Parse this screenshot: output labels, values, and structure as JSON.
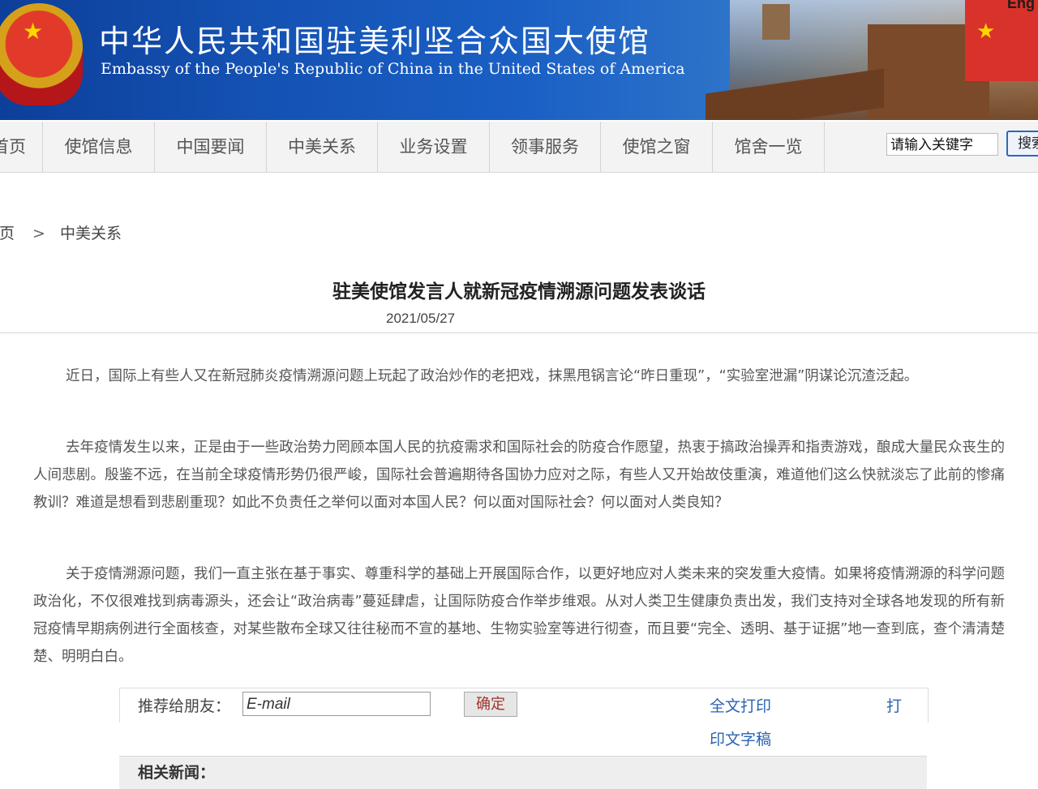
{
  "header": {
    "title_cn": "中华人民共和国驻美利坚合众国大使馆",
    "title_en": "Embassy of the People's Republic of China in the United States of America",
    "lang_link": "Eng"
  },
  "nav": {
    "items": [
      {
        "label": "首页"
      },
      {
        "label": "使馆信息"
      },
      {
        "label": "中国要闻"
      },
      {
        "label": "中美关系"
      },
      {
        "label": "业务设置"
      },
      {
        "label": "领事服务"
      },
      {
        "label": "使馆之窗"
      },
      {
        "label": "馆舍一览"
      }
    ],
    "search_placeholder": "请输入关键字",
    "search_button": "搜索"
  },
  "breadcrumb": {
    "home": "首页",
    "separator": ">",
    "current": "中美关系"
  },
  "article": {
    "title": "驻美使馆发言人就新冠疫情溯源问题发表谈话",
    "date": "2021/05/27",
    "paragraphs": [
      "近日，国际上有些人又在新冠肺炎疫情溯源问题上玩起了政治炒作的老把戏，抹黑甩锅言论“昨日重现”，“实验室泄漏”阴谋论沉渣泛起。",
      "去年疫情发生以来，正是由于一些政治势力罔顾本国人民的抗疫需求和国际社会的防疫合作愿望，热衷于搞政治操弄和指责游戏，酿成大量民众丧生的人间悲剧。殷鉴不远，在当前全球疫情形势仍很严峻，国际社会普遍期待各国协力应对之际，有些人又开始故伎重演，难道他们这么快就淡忘了此前的惨痛教训？难道是想看到悲剧重现？如此不负责任之举何以面对本国人民？何以面对国际社会？何以面对人类良知？",
      "关于疫情溯源问题，我们一直主张在基于事实、尊重科学的基础上开展国际合作，以更好地应对人类未来的突发重大疫情。如果将疫情溯源的科学问题政治化，不仅很难找到病毒源头，还会让“政治病毒”蔓延肆虐，让国际防疫合作举步维艰。从对人类卫生健康负责出发，我们支持对全球各地发现的所有新冠疫情早期病例进行全面核查，对某些散布全球又往往秘而不宣的基地、生物实验室等进行彻查，而且要“完全、透明、基于证据”地一查到底，查个清清楚楚、明明白白。"
    ]
  },
  "share": {
    "label": "推荐给朋友：",
    "email_placeholder": "E-mail",
    "ok_button": "确定",
    "print_full": "全文打印",
    "print_short": "打",
    "print_text": "印文字稿"
  },
  "related": {
    "label": "相关新闻："
  },
  "colors": {
    "banner_blue": "#1452b3",
    "link_blue": "#2b63b0",
    "button_text_red": "#a1322a"
  }
}
